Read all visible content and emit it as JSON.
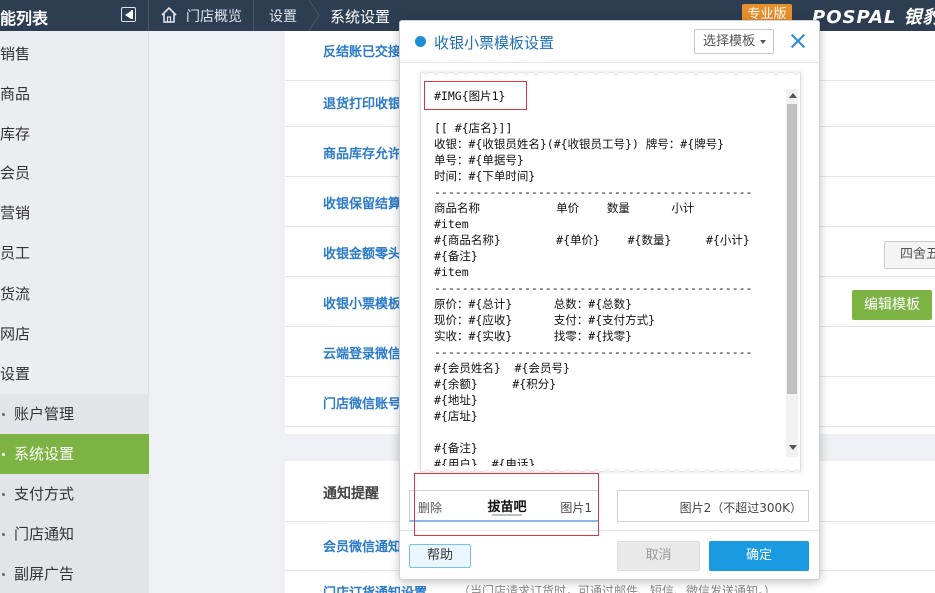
{
  "topbar": {
    "app_title": "能列表",
    "breadcrumb": [
      "门店概览",
      "设置",
      "系统设置"
    ],
    "edition_badge": "专业版",
    "brand": "POSPAL 银豹"
  },
  "sidebar": {
    "items": [
      "销售",
      "商品",
      "库存",
      "会员",
      "营销",
      "员工",
      "货流",
      "网店",
      "设置"
    ],
    "sub_items": [
      "账户管理",
      "系统设置",
      "支付方式",
      "门店通知",
      "副屏广告"
    ],
    "active_sub": "系统设置"
  },
  "settings": {
    "rows": [
      "反结账已交接",
      "退货打印收银",
      "商品库存允许",
      "收银保留结算",
      "收银金额零头",
      "收银小票模板",
      "云端登录微信",
      "门店微信账号"
    ],
    "rounding_value": "四舍五",
    "edit_template_button": "编辑模板",
    "notify_section_title": "通知提醒",
    "notify_rows": [
      "会员微信通知",
      "门店订货通知设置"
    ],
    "notify_hint": "（当门店请求订货时，可通过邮件、短信、微信发送通知。）"
  },
  "modal": {
    "title": "收银小票模板设置",
    "template_select": "选择模板",
    "receipt_lines": [
      "#IMG{图片1}",
      "",
      "[[ #{店名}]]",
      "收银：#{收银员姓名}(#{收银员工号}) 牌号：#{牌号}",
      "单号：#{单据号}",
      "时间：#{下单时间}",
      "----------------------------------------------",
      "商品名称           单价    数量      小计",
      "#item",
      "#{商品名称}        #{单价}    #{数量}     #{小计}",
      "#{备注}",
      "#item",
      "----------------------------------------------",
      "原价：#{总计}      总数：#{总数}",
      "现价：#{应收}      支付：#{支付方式}",
      "实收：#{实收}      找零：#{找零}",
      "----------------------------------------------",
      "#{会员姓名}  #{会员号}",
      "#{余额}     #{积分}",
      "#{地址}",
      "#{店址}",
      "",
      "#{备注}",
      "#{用户}  #{电话}"
    ],
    "image1": {
      "delete_label": "删除",
      "stamp_text": "拔苗吧",
      "label": "图片1"
    },
    "image2": {
      "label": "图片2（不超过300K）"
    },
    "help_button": "帮助",
    "cancel_button": "取消",
    "confirm_button": "确定"
  },
  "colors": {
    "topbar_bg": "#2e3e52",
    "accent_green": "#7cb342",
    "accent_blue": "#1a9ae0",
    "highlight_red": "#d9363e",
    "edition_orange": "#e8912c"
  }
}
